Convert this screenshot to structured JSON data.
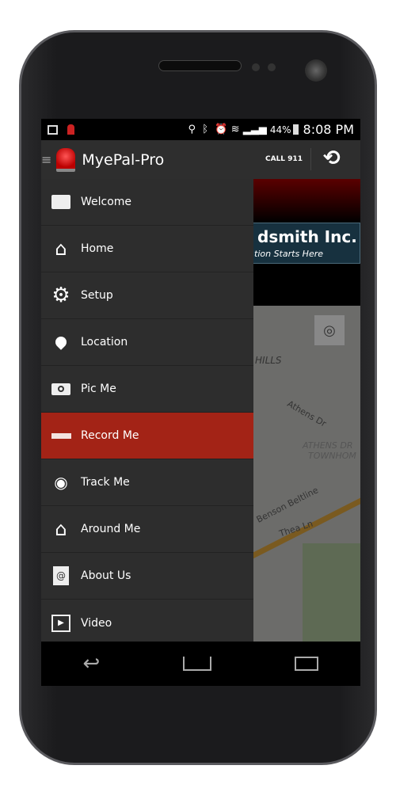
{
  "status": {
    "battery": "44%",
    "time": "8:08 PM"
  },
  "appbar": {
    "title": "MyePal-Pro",
    "call_label": "CALL 911"
  },
  "banner": {
    "company": "dsmith Inc.",
    "tagline": "tion Starts Here"
  },
  "map": {
    "labels": [
      "HILLS",
      "Athens Dr",
      "ATHENS DR",
      "TOWNHOM",
      "Benson Beltline",
      "Thea Ln"
    ]
  },
  "drawer": {
    "items": [
      {
        "label": "Welcome",
        "icon": "welcome-calendar-icon"
      },
      {
        "label": "Home",
        "icon": "home-icon"
      },
      {
        "label": "Setup",
        "icon": "gear-icon"
      },
      {
        "label": "Location",
        "icon": "location-pin-icon"
      },
      {
        "label": "Pic Me",
        "icon": "camera-icon"
      },
      {
        "label": "Record Me",
        "icon": "record-icon",
        "active": true
      },
      {
        "label": "Track Me",
        "icon": "track-icon"
      },
      {
        "label": "Around Me",
        "icon": "home-icon"
      },
      {
        "label": "About Us",
        "icon": "address-book-icon"
      },
      {
        "label": "Video",
        "icon": "play-icon"
      }
    ]
  },
  "colors": {
    "active": "#a32316",
    "drawer": "#2d2d2d"
  }
}
